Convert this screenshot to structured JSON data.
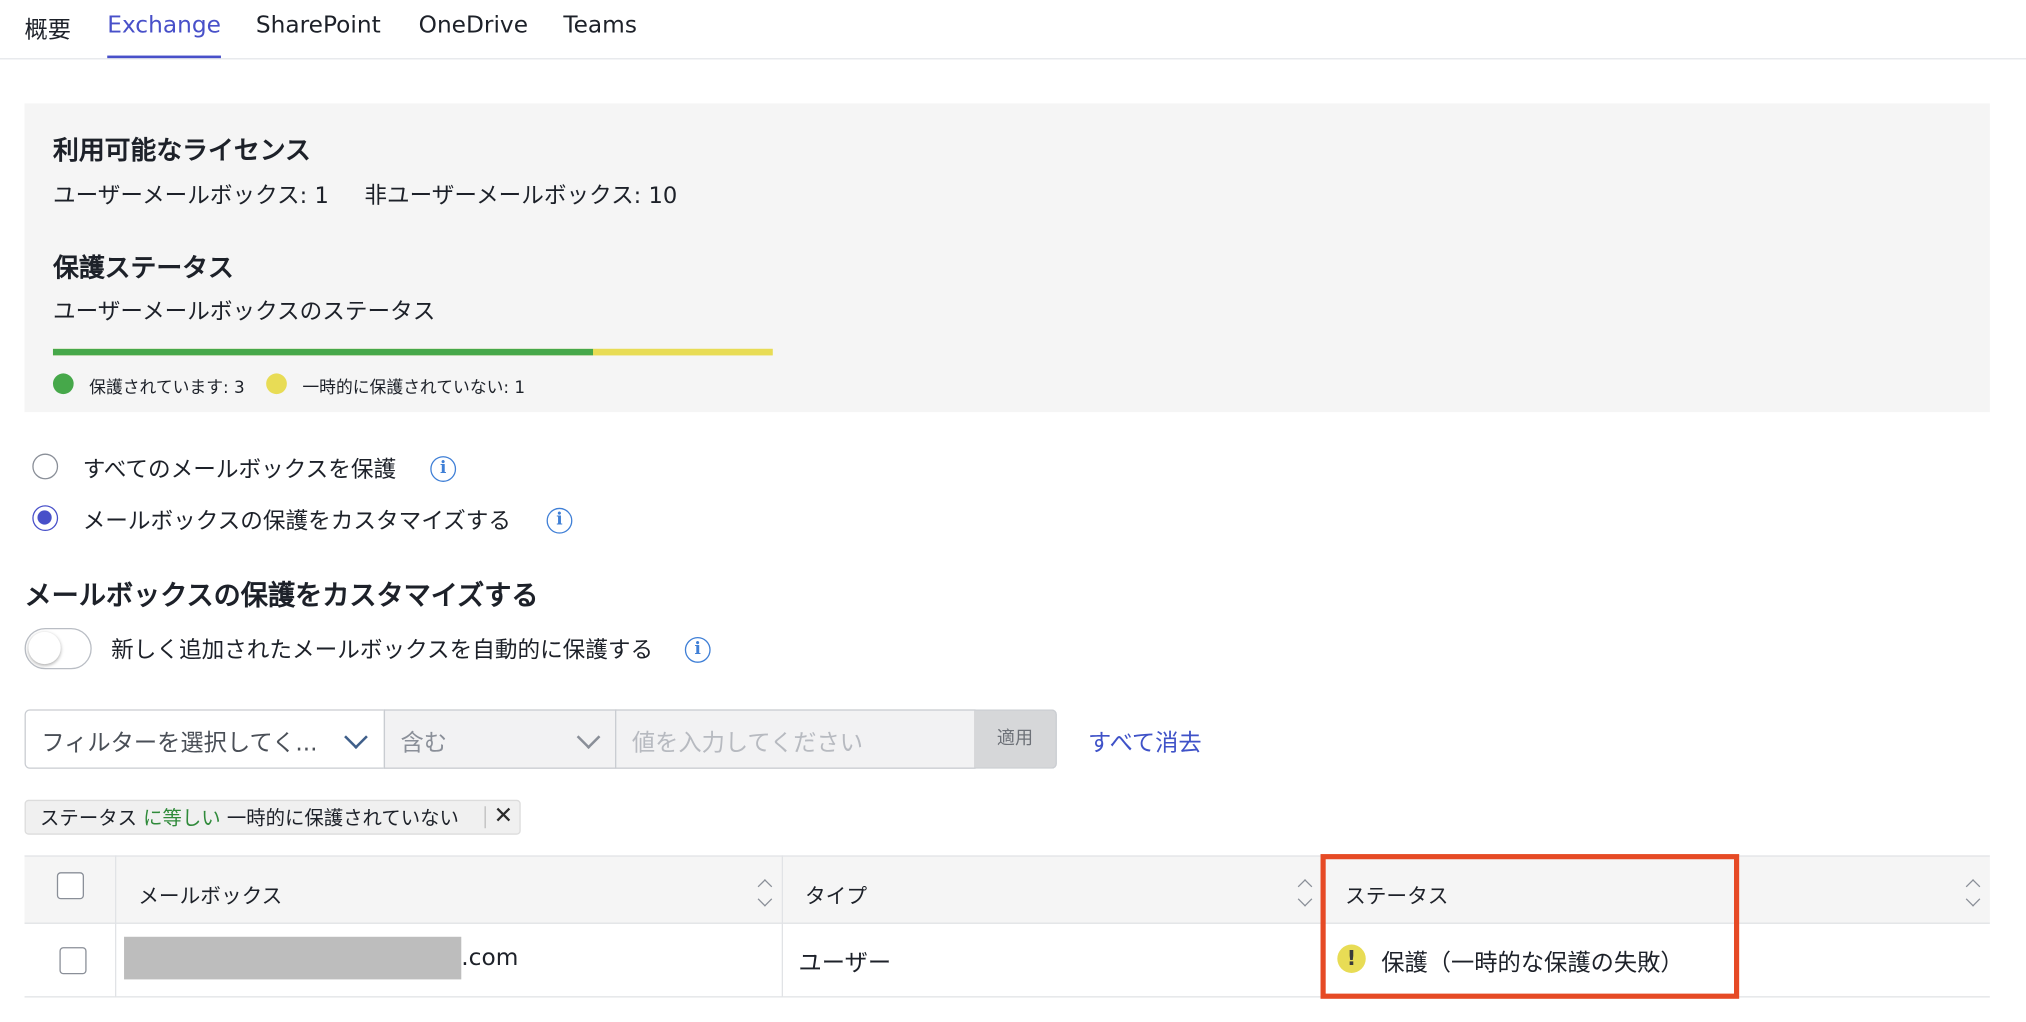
{
  "tabs": [
    {
      "label": "概要"
    },
    {
      "label": "Exchange"
    },
    {
      "label": "SharePoint"
    },
    {
      "label": "OneDrive"
    },
    {
      "label": "Teams"
    }
  ],
  "active_tab": "Exchange",
  "licenses": {
    "heading": "利用可能なライセンス",
    "user_mailbox": "ユーザーメールボックス: 1",
    "non_user_mailbox": "非ユーザーメールボックス: 10"
  },
  "protection": {
    "heading": "保護ステータス",
    "subheading": "ユーザーメールボックスのステータス",
    "protected_fraction": 0.75,
    "legend": [
      {
        "label": "保護されています: 3",
        "color": "#46a84a"
      },
      {
        "label": "一時的に保護されていない: 1",
        "color": "#e8dc55"
      }
    ]
  },
  "protection_mode": {
    "options": [
      {
        "label": "すべてのメールボックスを保護",
        "checked": false
      },
      {
        "label": "メールボックスの保護をカスタマイズする",
        "checked": true
      }
    ]
  },
  "customize": {
    "title": "メールボックスの保護をカスタマイズする",
    "auto_protect_label": "新しく追加されたメールボックスを自動的に保護する",
    "auto_protect_on": false
  },
  "filter": {
    "field_placeholder": "フィルターを選択してく...",
    "operator": "含む",
    "value_placeholder": "値を入力してください",
    "apply_label": "適用",
    "clear_label": "すべて消去"
  },
  "active_filter": {
    "field": "ステータス",
    "operator": "に等しい",
    "value": "一時的に保護されていない"
  },
  "table": {
    "columns": [
      "メールボックス",
      "タイプ",
      "ステータス"
    ],
    "rows": [
      {
        "mailbox_suffix": ".com",
        "type": "ユーザー",
        "status": "保護（一時的な保護の失敗）"
      }
    ]
  },
  "icons": {
    "info": "info-icon",
    "warning": "warning-icon",
    "close": "close-icon",
    "chevron": "chevron-down-icon",
    "sort": "sort-icon"
  },
  "colors": {
    "accent": "#4850c9",
    "link": "#3f52c8",
    "protected": "#46a84a",
    "unprotected": "#e8dc55",
    "highlight": "#e64a25"
  }
}
